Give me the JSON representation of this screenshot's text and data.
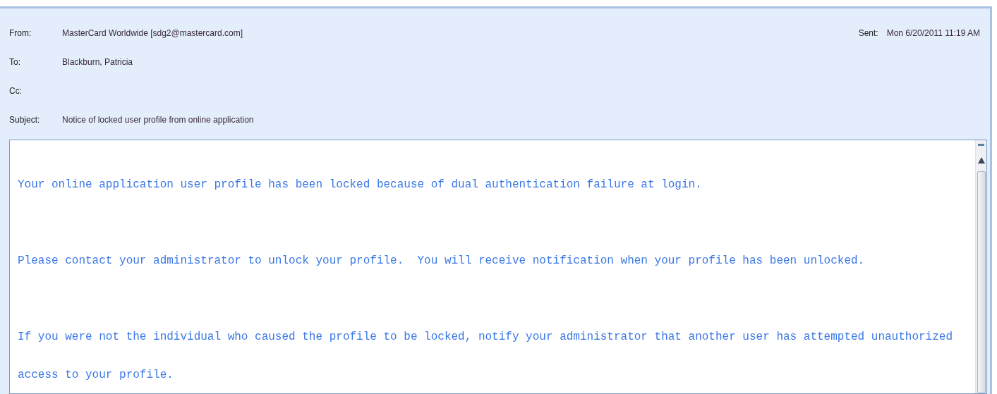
{
  "header": {
    "fields": [
      {
        "label": "From:",
        "value": "MasterCard Worldwide [sdg2@mastercard.com]"
      },
      {
        "label": "To:",
        "value": "Blackburn, Patricia"
      },
      {
        "label": "Cc:"
      },
      {
        "label": "Subject:",
        "value": "Notice of locked user profile from online application"
      }
    ],
    "sent": {
      "label": "Sent:",
      "value": "Mon 6/20/2011 11:19 AM"
    }
  },
  "body": {
    "paragraphs": [
      "Your online application user profile has been locked because of dual authentication failure at login.",
      "Please contact your administrator to unlock your profile.  You will receive notification when your profile has been unlocked.",
      "If you were not the individual who caused the profile to be locked, notify your administrator that another user has attempted unauthorized access to your profile."
    ]
  }
}
